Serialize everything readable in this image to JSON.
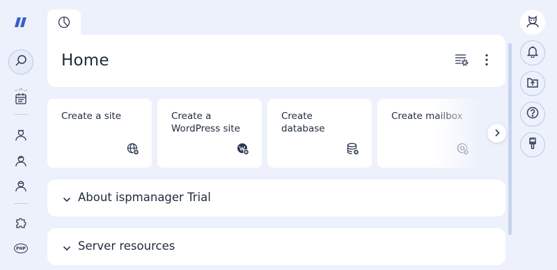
{
  "page": {
    "title": "Home"
  },
  "cards": [
    {
      "label": "Create a site",
      "icon": "globe-plus-icon"
    },
    {
      "label": "Create a WordPress site",
      "icon": "wordpress-plus-icon"
    },
    {
      "label": "Create database",
      "icon": "database-plus-icon"
    },
    {
      "label": "Create mailbox",
      "icon": "mail-plus-icon"
    }
  ],
  "sections": [
    {
      "title": "About ispmanager Trial"
    },
    {
      "title": "Server resources"
    }
  ],
  "sidebar": {
    "php_label": "PHP",
    "items": [
      "search-icon",
      "calendar-icon",
      "user-icon",
      "user-admin-icon",
      "user-reseller-icon",
      "puzzle-icon",
      "php-icon"
    ]
  },
  "rail": [
    "user-avatar-icon",
    "bell-icon",
    "file-upload-icon",
    "help-icon",
    "brush-icon"
  ],
  "colors": {
    "background": "#edf1fb",
    "card": "#ffffff",
    "text": "#1f2a3d",
    "accent": "#2f5bd3"
  }
}
